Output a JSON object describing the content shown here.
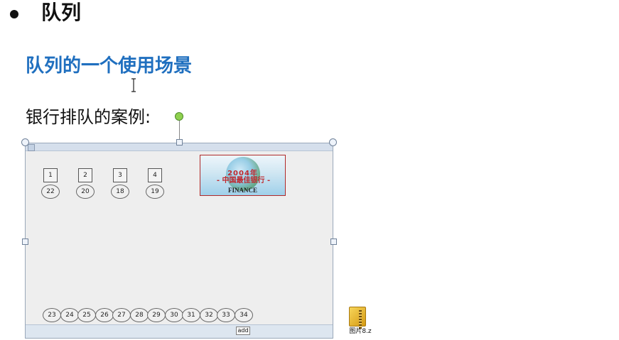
{
  "slide": {
    "title": "队列",
    "subtitle": "队列的一个使用场景",
    "case_label": "银行排队的案例:"
  },
  "demo": {
    "windows": [
      {
        "number": "1",
        "serving": "22"
      },
      {
        "number": "2",
        "serving": "20"
      },
      {
        "number": "3",
        "serving": "18"
      },
      {
        "number": "4",
        "serving": "19"
      }
    ],
    "queue": [
      "23",
      "24",
      "25",
      "26",
      "27",
      "28",
      "29",
      "30",
      "31",
      "32",
      "33",
      "34"
    ],
    "logo": {
      "year": "2004年",
      "title": "- 中国最佳银行 -",
      "brand": "FINANCE"
    },
    "add_button_label": "add"
  },
  "desktop": {
    "file_icon": "zip-folder-icon",
    "file_name": "图片8.z"
  },
  "colors": {
    "subtitle": "#1f6fbf",
    "handle_green": "#8fd14f",
    "logo_red": "#c0282d"
  }
}
